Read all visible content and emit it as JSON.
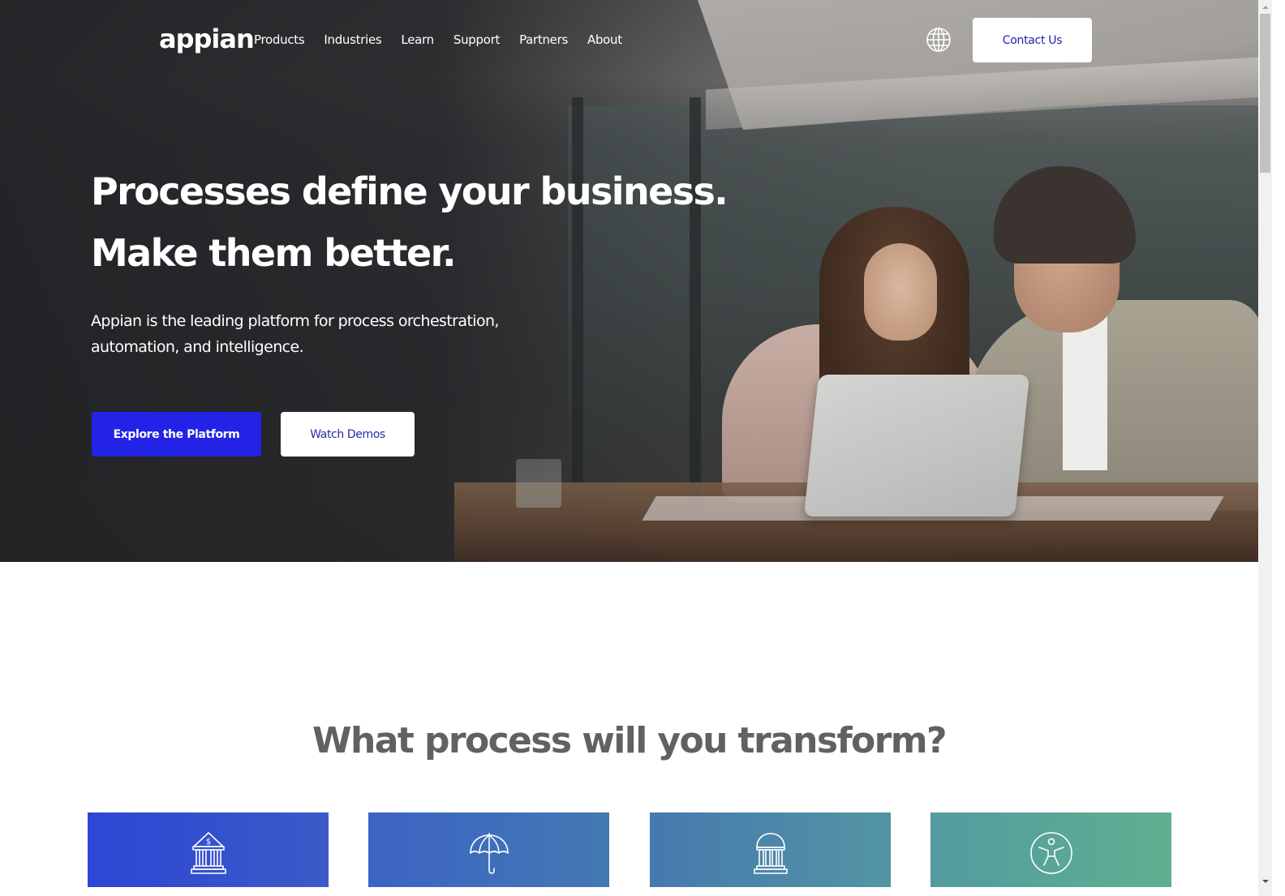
{
  "brand": {
    "logo_text": "appian",
    "accent_color": "#2323e8",
    "link_color": "#2a2aa8"
  },
  "nav": {
    "items": [
      {
        "label": "Products"
      },
      {
        "label": "Industries"
      },
      {
        "label": "Learn"
      },
      {
        "label": "Support"
      },
      {
        "label": "Partners"
      },
      {
        "label": "About"
      }
    ],
    "language_icon": "globe-icon",
    "contact_label": "Contact Us"
  },
  "hero": {
    "title_line1": "Processes define your business.",
    "title_line2": "Make them better.",
    "subtitle": "Appian is the leading platform for process orchestration, automation, and intelligence.",
    "primary_cta": "Explore the Platform",
    "secondary_cta": "Watch Demos",
    "image_description": "Two business people working on a laptop at a conference table"
  },
  "section": {
    "title": "What process will you transform?",
    "cards": [
      {
        "icon": "bank-dollar-icon",
        "color_start": "#2d46d4",
        "color_end": "#3a5bc7"
      },
      {
        "icon": "umbrella-icon",
        "color_start": "#3c63c4",
        "color_end": "#4379b2"
      },
      {
        "icon": "government-building-icon",
        "color_start": "#4679af",
        "color_end": "#5395a4"
      },
      {
        "icon": "accessibility-icon",
        "color_start": "#539b9f",
        "color_end": "#5fb090"
      }
    ]
  }
}
